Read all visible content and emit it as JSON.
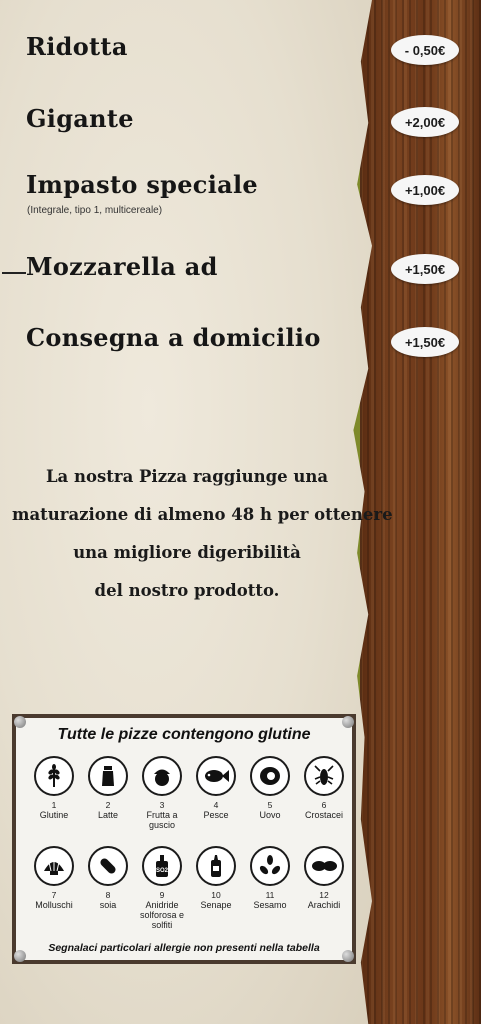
{
  "menu_extras": [
    {
      "name": "Ridotta",
      "price": "- 0,50€"
    },
    {
      "name": "Gigante",
      "price": "+2,00€"
    },
    {
      "name": "Impasto speciale",
      "note": "(Integrale, tipo 1, multicereale)",
      "price": "+1,00€"
    },
    {
      "name": "Mozzarella ad",
      "price": "+1,50€"
    },
    {
      "name": "Consegna a domicilio",
      "price": "+1,50€"
    }
  ],
  "note": {
    "lines": [
      "La nostra Pizza raggiunge una",
      "maturazione di almeno 48 h per ottenere",
      "una migliore digeribilità",
      "del nostro prodotto."
    ]
  },
  "allergens": {
    "title": "Tutte le pizze contengono glutine",
    "items": [
      {
        "num": "1",
        "label": "Glutine",
        "icon": "wheat-icon"
      },
      {
        "num": "2",
        "label": "Latte",
        "icon": "milk-bottle-icon"
      },
      {
        "num": "3",
        "label": "Frutta a guscio",
        "icon": "nut-icon"
      },
      {
        "num": "4",
        "label": "Pesce",
        "icon": "fish-icon"
      },
      {
        "num": "5",
        "label": "Uovo",
        "icon": "egg-icon"
      },
      {
        "num": "6",
        "label": "Crostacei",
        "icon": "shrimp-icon"
      },
      {
        "num": "7",
        "label": "Molluschi",
        "icon": "shell-icon"
      },
      {
        "num": "8",
        "label": "soia",
        "icon": "soy-icon"
      },
      {
        "num": "9",
        "label": "Anidride solforosa e solfiti",
        "icon": "so2-icon",
        "badge": "SO2"
      },
      {
        "num": "10",
        "label": "Senape",
        "icon": "mustard-icon"
      },
      {
        "num": "11",
        "label": "Sesamo",
        "icon": "sesame-icon"
      },
      {
        "num": "12",
        "label": "Arachidi",
        "icon": "peanut-icon"
      }
    ],
    "footer": "Segnalaci particolari allergie non presenti nella tabella"
  }
}
